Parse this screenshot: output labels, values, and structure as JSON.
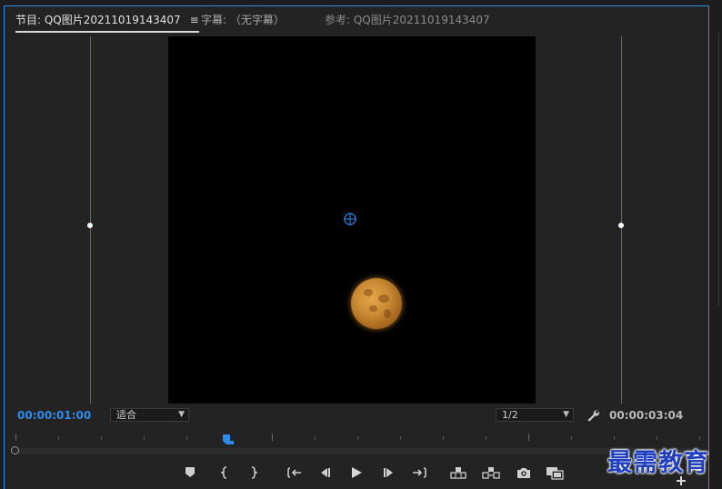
{
  "tabs": {
    "program": "节目: QQ图片20211019143407",
    "menu_icon": "≡",
    "captions": "字幕: （无字幕）",
    "reference": "参考: QQ图片20211019143407"
  },
  "timecode": {
    "current": "00:00:01:00",
    "duration": "00:00:03:04"
  },
  "zoom_select": {
    "value": "适合"
  },
  "resolution_select": {
    "value": "1/2"
  },
  "playhead_position": 0.31,
  "controls": [
    {
      "name": "add-marker-button",
      "icon": "marker-icon"
    },
    {
      "name": "mark-in-button",
      "icon": "mark-in-icon"
    },
    {
      "name": "mark-out-button",
      "icon": "mark-out-icon"
    },
    {
      "name": "go-to-in-button",
      "icon": "go-to-in-icon"
    },
    {
      "name": "step-back-button",
      "icon": "step-back-icon"
    },
    {
      "name": "play-button",
      "icon": "play-icon"
    },
    {
      "name": "step-forward-button",
      "icon": "step-forward-icon"
    },
    {
      "name": "go-to-out-button",
      "icon": "go-to-out-icon"
    },
    {
      "name": "lift-button",
      "icon": "lift-icon"
    },
    {
      "name": "extract-button",
      "icon": "extract-icon"
    },
    {
      "name": "export-frame-button",
      "icon": "camera-icon"
    },
    {
      "name": "comparison-view-button",
      "icon": "comparison-icon"
    },
    {
      "name": "button-editor-button",
      "icon": "plus-icon"
    }
  ],
  "colors": {
    "accent": "#2d8ceb",
    "panel_bg": "#232323",
    "viewer_bg": "#000000"
  },
  "watermark": "最需教育"
}
